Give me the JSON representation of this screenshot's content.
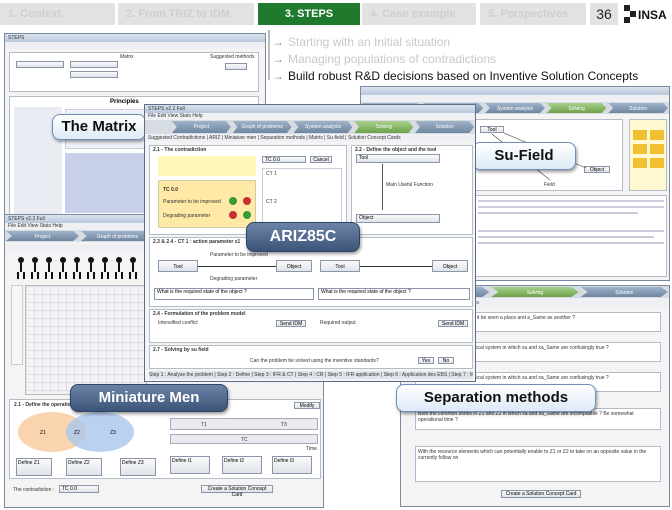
{
  "nav": {
    "tabs": [
      {
        "label": "1. Context"
      },
      {
        "label": "2. From TRIZ to IDM"
      },
      {
        "label": "3. STEPS"
      },
      {
        "label": "4. Case example"
      },
      {
        "label": "5. Perspectives"
      }
    ],
    "page_number": "36",
    "logo_text": "INSA"
  },
  "bullets": [
    "Starting with an Initial situation",
    "Managing populations of contradictions",
    "Build robust R&D decisions based on Inventive Solution Concepts"
  ],
  "labels": {
    "matrix": "The Matrix",
    "sufield": "Su-Field",
    "ariz": "ARIZ85C",
    "miniature": "Miniature Men",
    "separation": "Separation methods"
  },
  "ariz_window": {
    "title": "STEPS v2.2 Full",
    "menu": "File  Edit  View  Stats  Help",
    "process_tabs": [
      "Project",
      "Graph of problems",
      "System analysis",
      "Solving",
      "Solution"
    ],
    "sub_tabs": "Suggested Contradictions | ARIZ | Miniature men | Separation methods | Matrix | Su-field | Solution Concept Cards",
    "section_21": "2.1 - The contradiction",
    "section_22": "2.2 - Define the object and the tool",
    "tc_label": "TC 0.0",
    "ct1": "CT 1",
    "ct2": "CT 2",
    "cancel": "Cancel",
    "tool": "Tool",
    "object": "Object",
    "main_useful_function": "Main Useful Function",
    "tc_left": "TC 0.0",
    "degrading": "Degrading parameter",
    "parameter_improved": "Parameter to be improved",
    "section_23": "2.3 & 2.4 - CT 1 : action parameter x1",
    "section_24": "2.4 - Formulation of the problem model",
    "section_25": "2.7 - Solving by su field",
    "required_state": "What is the required state of the object ?",
    "intensified": "Intensified conflict",
    "required_output": "Required output",
    "send_idm": "Send IDM",
    "question": "Can the problem be solved using the inventive standards?",
    "yes": "Yes",
    "no": "No",
    "steps_bar": "Step 1 : Analyse the problem | Step 2 : Define | Step 3 : IFR & CT | Step 4 : CR | Step 5 : IFR application | Step 6 : Application des EBS | Step 7 : Modifications | Step 8 : Analysis | Step 9 : ISS | Step 10 : Stop"
  },
  "matrix_window": {
    "title": "Matrix",
    "principles": "Principles",
    "suggested": "Suggested methods"
  },
  "sufield_window": {
    "tool": "Tool",
    "object": "Object",
    "field": "Field",
    "main_useful": "Main Useful Function"
  },
  "miniature_window": {
    "process_tabs": [
      "Project",
      "Graph of problems"
    ],
    "define_heading": "2.1 - Define the operational zone",
    "zones": [
      "Z1",
      "Z2",
      "Z3"
    ],
    "defines": [
      "Define Z1",
      "Define Z2",
      "Define Z3"
    ],
    "contradiction_label": "The contradiction :",
    "tc_value": "TC 0.0",
    "time_label": "Time",
    "t1": "T1",
    "t2": "T2",
    "t3": "T3",
    "tc": "TC",
    "define_t": [
      "Define t1",
      "Define t2",
      "Define t3"
    ],
    "create_btn": "Create a Solution Concept Card",
    "modify": "Modify"
  },
  "separation_window": {
    "process_tabs": [
      "System analysis",
      "Solving",
      "Solution"
    ],
    "sub_tabs": "Su-field | Solution Concept Cards",
    "q1": "parameter of Element can it be seen a place and a_Same as another ?",
    "q2": "ms Z1 and Z2 of the technical system in which xa and xa_Same are confusingly true ?",
    "q3": "ms Z1 and Z2 of the technical system in which xa and xa_Same are confusingly true ?",
    "q4": "Both the common zones in Z1 and Z2 in which xa and xa_Same are incompatible ?\nBe somewhat operational time ?",
    "q5": "With the resource elements which can potentially enable to Z1 or Z2 to take on an opposite value in the currently follow on",
    "create_btn": "Create a Solution Concept Card"
  },
  "colors": {
    "nav_active": "#1f7a2e",
    "nav_inactive": "#e2e2e2",
    "label_dark": "#3c5478"
  }
}
